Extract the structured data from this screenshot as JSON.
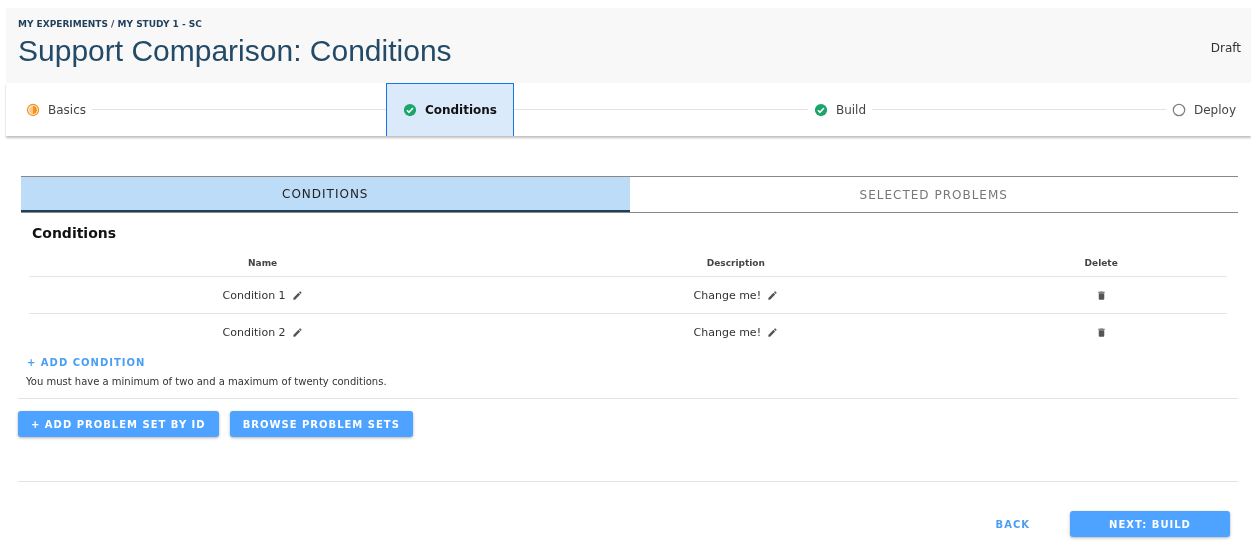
{
  "breadcrumb": "MY EXPERIMENTS / MY STUDY 1 - SC",
  "title": "Support Comparison: Conditions",
  "status": "Draft",
  "steps": [
    {
      "label": "Basics",
      "kind": "partial",
      "selected": false
    },
    {
      "label": "Conditions",
      "kind": "done",
      "selected": true
    },
    {
      "label": "Build",
      "kind": "done",
      "selected": false
    },
    {
      "label": "Deploy",
      "kind": "todo",
      "selected": false
    }
  ],
  "tabs": [
    {
      "label": "CONDITIONS",
      "selected": true
    },
    {
      "label": "SELECTED PROBLEMS",
      "selected": false
    }
  ],
  "section_title": "Conditions",
  "table": {
    "columns": [
      "Name",
      "Description",
      "Delete"
    ],
    "rows": [
      {
        "name": "Condition 1",
        "description": "Change me!"
      },
      {
        "name": "Condition 2",
        "description": "Change me!"
      }
    ]
  },
  "add_condition": "+ ADD CONDITION",
  "hint": "You must have a minimum of two and a maximum of twenty conditions.",
  "problem_buttons": [
    "+ ADD PROBLEM SET BY ID",
    "BROWSE PROBLEM SETS"
  ],
  "footer": {
    "back": "BACK",
    "next": "NEXT: BUILD"
  }
}
